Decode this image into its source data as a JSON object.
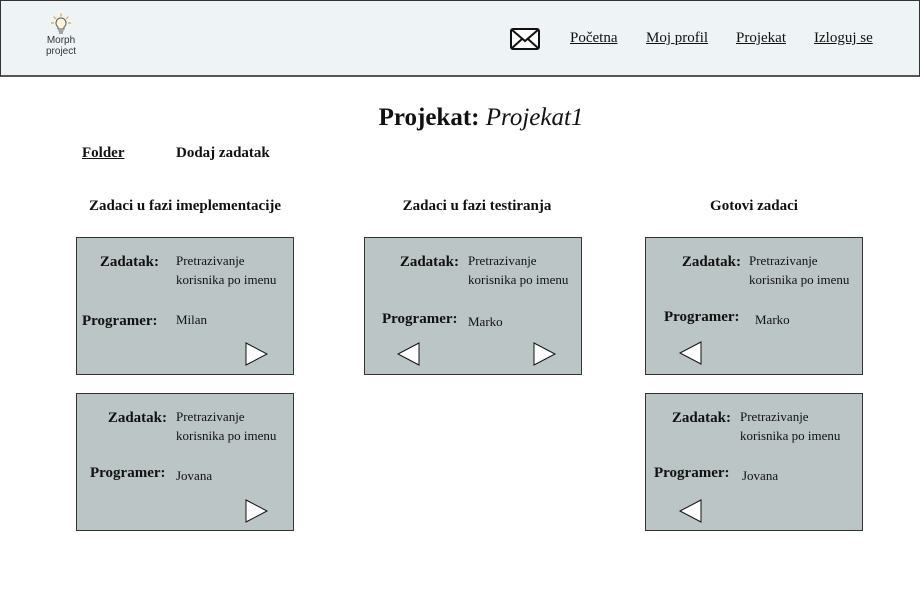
{
  "header": {
    "logo_line1": "Morph",
    "logo_line2": "project",
    "mail_icon": "envelope-icon",
    "nav": [
      "Početna",
      "Moj profil",
      "Projekat",
      "Izloguj se"
    ]
  },
  "page": {
    "title_label": "Projekat:",
    "title_value": "Projekat1",
    "folder_link": "Folder",
    "add_task": "Dodaj zadatak"
  },
  "columns": [
    {
      "title": "Zadaci u fazi imeplementacije"
    },
    {
      "title": "Zadaci u fazi testiranja"
    },
    {
      "title": "Gotovi zadaci"
    }
  ],
  "labels": {
    "task": "Zadatak:",
    "programmer": "Programer:"
  },
  "cards": [
    {
      "task_line1": "Pretrazivanje",
      "task_line2": "korisnika po imenu",
      "programmer": "Milan"
    },
    {
      "task_line1": "Pretrazivanje",
      "task_line2": "korisnika po imenu",
      "programmer": "Jovana"
    },
    {
      "task_line1": "Pretrazivanje",
      "task_line2": "korisnika po imenu",
      "programmer": "Marko"
    },
    {
      "task_line1": "Pretrazivanje",
      "task_line2": "korisnika po imenu",
      "programmer": "Marko"
    },
    {
      "task_line1": "Pretrazivanje",
      "task_line2": "korisnika po imenu",
      "programmer": "Jovana"
    }
  ],
  "colors": {
    "header_bg": "#eef3f5",
    "card_bg": "#bcc5c5"
  }
}
